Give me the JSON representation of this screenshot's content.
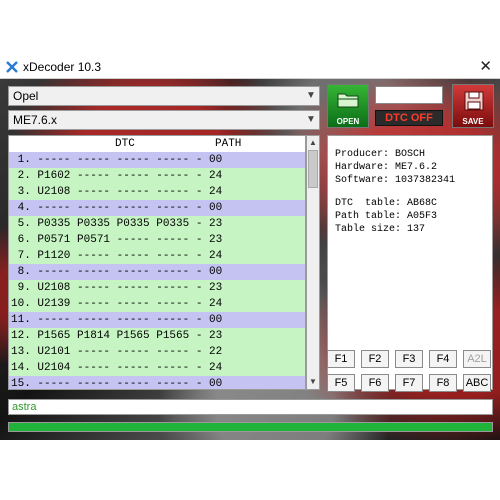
{
  "window": {
    "title": "xDecoder 10.3",
    "close_glyph": "✕"
  },
  "icons": {
    "app": "xdecoder-app-icon",
    "open": "folder-icon",
    "save": "floppy-disk-icon"
  },
  "brand_select": {
    "value": "Opel"
  },
  "ecu_select": {
    "value": "ME7.6.x"
  },
  "toolbar": {
    "open_label": "OPEN",
    "save_label": "SAVE",
    "dtc_status": "DTC OFF",
    "top_input_value": ""
  },
  "dtc_list": {
    "headers": {
      "dtc": "DTC",
      "path": "PATH"
    },
    "rows": [
      {
        "text": " 1. ----- ----- ----- ----- - 00",
        "state": "off"
      },
      {
        "text": " 2. P1602 ----- ----- ----- - 24",
        "state": "on"
      },
      {
        "text": " 3. U2108 ----- ----- ----- - 24",
        "state": "on"
      },
      {
        "text": " 4. ----- ----- ----- ----- - 00",
        "state": "off"
      },
      {
        "text": " 5. P0335 P0335 P0335 P0335 - 23",
        "state": "on"
      },
      {
        "text": " 6. P0571 P0571 ----- ----- - 23",
        "state": "on"
      },
      {
        "text": " 7. P1120 ----- ----- ----- - 24",
        "state": "on"
      },
      {
        "text": " 8. ----- ----- ----- ----- - 00",
        "state": "off"
      },
      {
        "text": " 9. U2108 ----- ----- ----- - 23",
        "state": "on"
      },
      {
        "text": "10. U2139 ----- ----- ----- - 24",
        "state": "on"
      },
      {
        "text": "11. ----- ----- ----- ----- - 00",
        "state": "off"
      },
      {
        "text": "12. P1565 P1814 P1565 P1565 - 23",
        "state": "on"
      },
      {
        "text": "13. U2101 ----- ----- ----- - 22",
        "state": "on"
      },
      {
        "text": "14. U2104 ----- ----- ----- - 24",
        "state": "on"
      },
      {
        "text": "15. ----- ----- ----- ----- - 00",
        "state": "off"
      }
    ]
  },
  "info": {
    "producer": "Producer: BOSCH",
    "hardware": "Hardware: ME7.6.2",
    "software": "Software: 1037382341",
    "dtc_table": "DTC  table: AB68C",
    "path_table": "Path table: A05F3",
    "table_size": "Table size: 137"
  },
  "function_keys": [
    {
      "label": "F1",
      "enabled": true
    },
    {
      "label": "F2",
      "enabled": true
    },
    {
      "label": "F3",
      "enabled": true
    },
    {
      "label": "F4",
      "enabled": true
    },
    {
      "label": "A2L",
      "enabled": false
    },
    {
      "label": "F5",
      "enabled": true
    },
    {
      "label": "F6",
      "enabled": true
    },
    {
      "label": "F7",
      "enabled": true
    },
    {
      "label": "F8",
      "enabled": true
    },
    {
      "label": "ABC",
      "enabled": true
    }
  ],
  "status": {
    "text": "astra"
  },
  "progress": {
    "fraction": 1.0
  },
  "colors": {
    "row_on": "#c6f5c3",
    "row_off": "#c5c3f2",
    "dtc_off": "#ff3b2a",
    "progress": "#1fb33a",
    "status_text": "#2e9b2e"
  }
}
